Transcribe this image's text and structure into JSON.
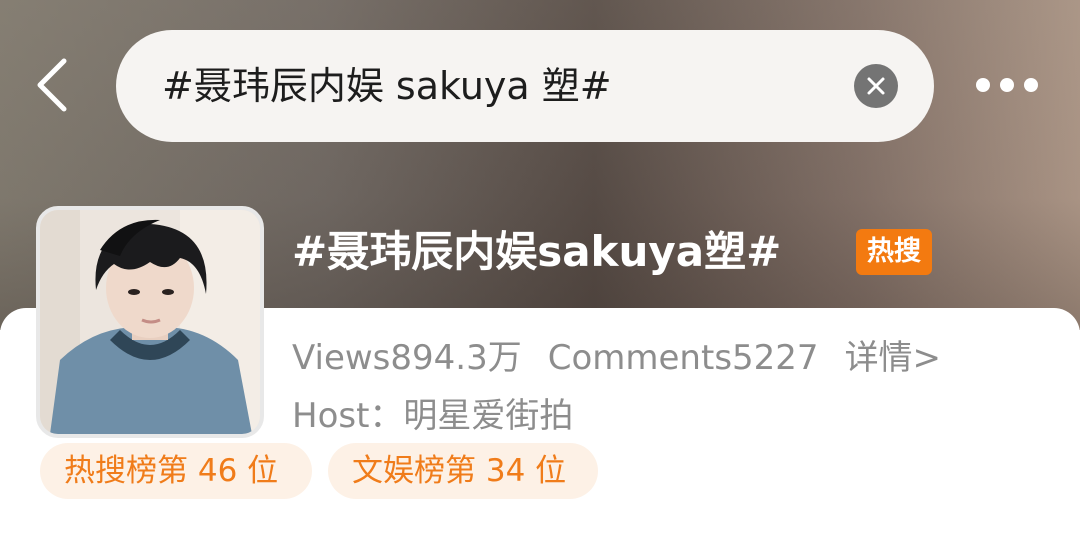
{
  "search": {
    "query": "#聂玮辰内娱 sakuya 塑#"
  },
  "topic": {
    "title": "#聂玮辰内娱sakuya塑#",
    "hot_badge": "热搜",
    "views_label": "Views894.3万",
    "comments_label": "Comments5227",
    "details_link": "详情>",
    "host_label": "Host：明星爱街拍"
  },
  "rankings": [
    {
      "label": "热搜榜第 46 位"
    },
    {
      "label": "文娱榜第 34 位"
    }
  ],
  "colors": {
    "accent_orange": "#f37a10",
    "rank_text": "#f07c1a",
    "rank_bg": "#fdf1e6",
    "meta_gray": "#8d8d8d"
  },
  "icons": {
    "back": "chevron-left-icon",
    "clear": "close-circle-icon",
    "more": "more-horizontal-icon"
  }
}
